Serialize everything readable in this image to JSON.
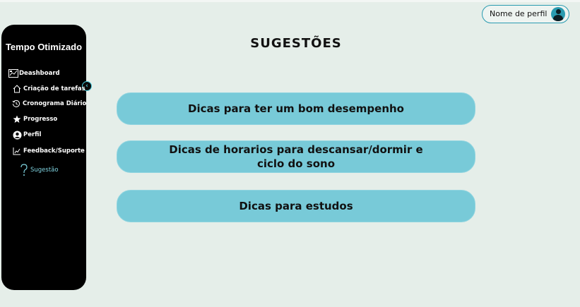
{
  "header": {
    "profile_label": "Nome de perfil",
    "profile_icon": "user-avatar-icon"
  },
  "sidebar": {
    "title": "Tempo Otimizado",
    "collapse_icon": "chevron-left-icon",
    "items": [
      {
        "label": "Deashboard",
        "icon": "dashboard-icon"
      },
      {
        "label": "Criação de tarefas",
        "icon": "home-icon"
      },
      {
        "label": "Cronograma Diário",
        "icon": "history-clock-icon"
      },
      {
        "label": "Progresso",
        "icon": "star-icon"
      },
      {
        "label": "Perfil",
        "icon": "user-icon"
      },
      {
        "label": "Feedback/Suporte",
        "icon": "feedback-icon"
      },
      {
        "label": "Sugestão",
        "icon": "question-icon",
        "active": true
      }
    ]
  },
  "main": {
    "title": "SUGESTÕES",
    "cards": [
      {
        "label": "Dicas para ter um bom desempenho"
      },
      {
        "label": "Dicas de horarios para descansar/dormir  e ciclo do sono"
      },
      {
        "label": "Dicas para estudos"
      }
    ]
  },
  "colors": {
    "background": "#e5eee9",
    "sidebar": "#000000",
    "accent": "#2a9bb0",
    "card": "#78cad8",
    "active_nav": "#7fd3e0"
  }
}
